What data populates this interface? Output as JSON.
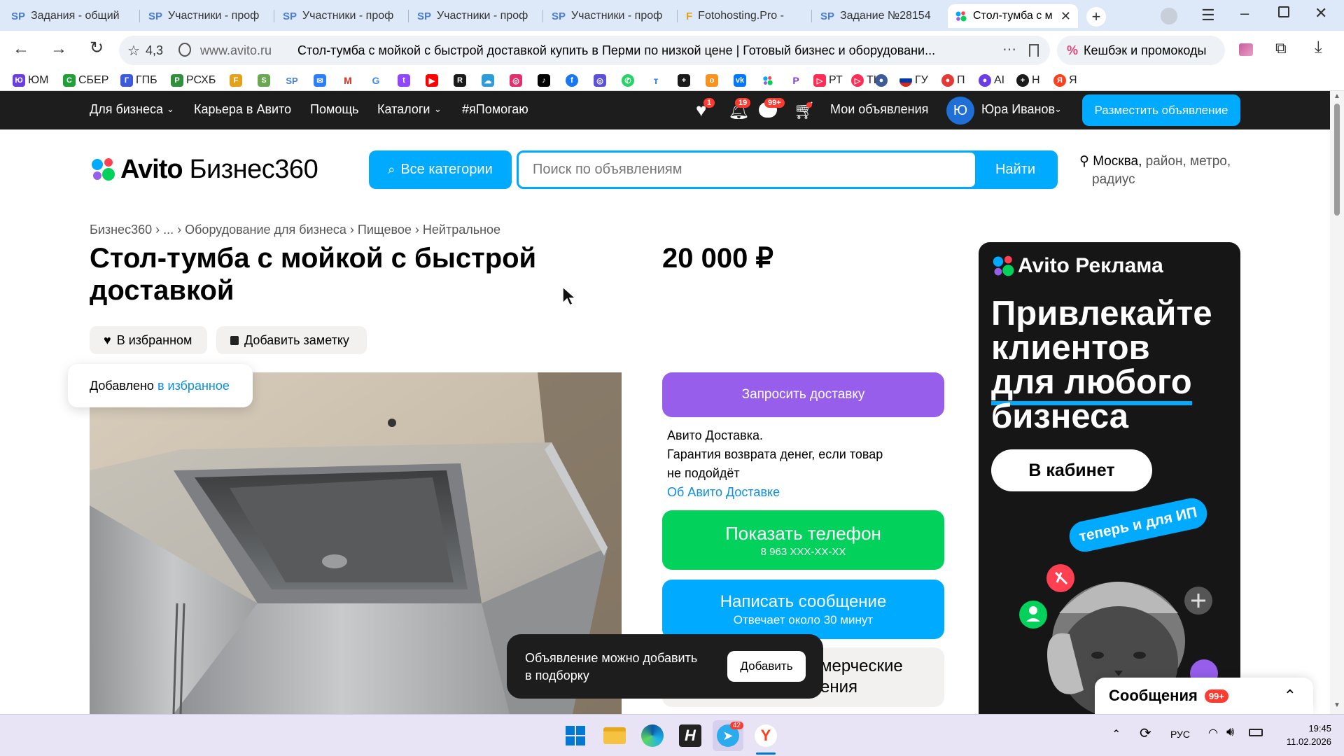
{
  "browser": {
    "tabs": [
      {
        "favicon": "SP",
        "title": "Задания - общий"
      },
      {
        "favicon": "SP",
        "title": "Участники - проф"
      },
      {
        "favicon": "SP",
        "title": "Участники - проф"
      },
      {
        "favicon": "SP",
        "title": "Участники - проф"
      },
      {
        "favicon": "SP",
        "title": "Участники - проф"
      },
      {
        "favicon": "F",
        "title": "Fotohosting.Pro - "
      },
      {
        "favicon": "SP",
        "title": "Задание №28154"
      },
      {
        "favicon": "avito",
        "title": "Стол-тумба с м"
      }
    ],
    "rating": "4,3",
    "domain": "www.avito.ru",
    "page_title": "Стол-тумба с мойкой с быстрой доставкой купить в Перми по низкой цене | Готовый бизнес и оборудовани...",
    "cashback_label": "Кешбэк и промокоды",
    "bookmarks": [
      "ЮМ",
      "СБЕР",
      "ГПБ",
      "РСХБ",
      "РТ",
      "ТК",
      "ГУ",
      "П",
      "AI",
      "Н",
      "Я"
    ]
  },
  "avito_header": {
    "nav": [
      "Для бизнеса",
      "Карьера в Авито",
      "Помощь",
      "Каталоги",
      "#яПомогаю"
    ],
    "badges": {
      "favorites": "1",
      "notifications": "19",
      "messages": "99+"
    },
    "my_ads": "Мои объявления",
    "user_initial": "Ю",
    "user_name": "Юра Иванов",
    "post_ad": "Разместить объявление"
  },
  "search": {
    "logo_text": "Avito",
    "logo_suffix": "Бизнес360",
    "categories_btn": "Все категории",
    "placeholder": "Поиск по объявлениям",
    "find_btn": "Найти",
    "location_city": "Москва,",
    "location_rest": "район, метро,",
    "location_radius": "радиус"
  },
  "breadcrumbs": [
    "Бизнес360",
    "...",
    "Оборудование для бизнеса",
    "Пищевое",
    "Нейтральное"
  ],
  "listing": {
    "title_line1": "Стол-тумба с мойкой с быстрой",
    "title_line2": "доставкой",
    "price": "20 000 ₽",
    "favorite_btn": "В избранном",
    "note_btn": "Добавить заметку",
    "toast_prefix": "Добавлено",
    "toast_link": "в избранное",
    "delivery_btn": "Запросить доставку",
    "delivery_info_1": "Авито Доставка.",
    "delivery_info_2": "Гарантия возврата денег, если товар",
    "delivery_info_3": "не подойдёт",
    "delivery_link": "Об Авито Доставке",
    "phone_btn": "Показать телефон",
    "phone_masked": "8 963 XXX-XX-XX",
    "message_btn": "Написать сообщение",
    "message_sub": "Отвечает около 30 минут",
    "commercial_1": "мерческие",
    "commercial_2": "ения"
  },
  "collection_popup": {
    "text_1": "Объявление можно добавить",
    "text_2": "в подборку",
    "add_btn": "Добавить"
  },
  "ad_banner": {
    "brand": "Avito Реклама",
    "headline": [
      "Привлекайте",
      "клиентов",
      "для любого",
      "бизнеса"
    ],
    "cta": "В кабинет",
    "ribbon": "теперь и для ИП"
  },
  "messages_widget": {
    "label": "Сообщения",
    "count": "99+"
  },
  "taskbar": {
    "telegram_badge": "42",
    "lang": "РУС",
    "time": "19:45",
    "date": "11.02.2026"
  },
  "colors": {
    "avito_blue": "#00aaff",
    "avito_green": "#02d15c",
    "avito_purple": "#965eeb",
    "header_dark": "#1d1d1d"
  }
}
